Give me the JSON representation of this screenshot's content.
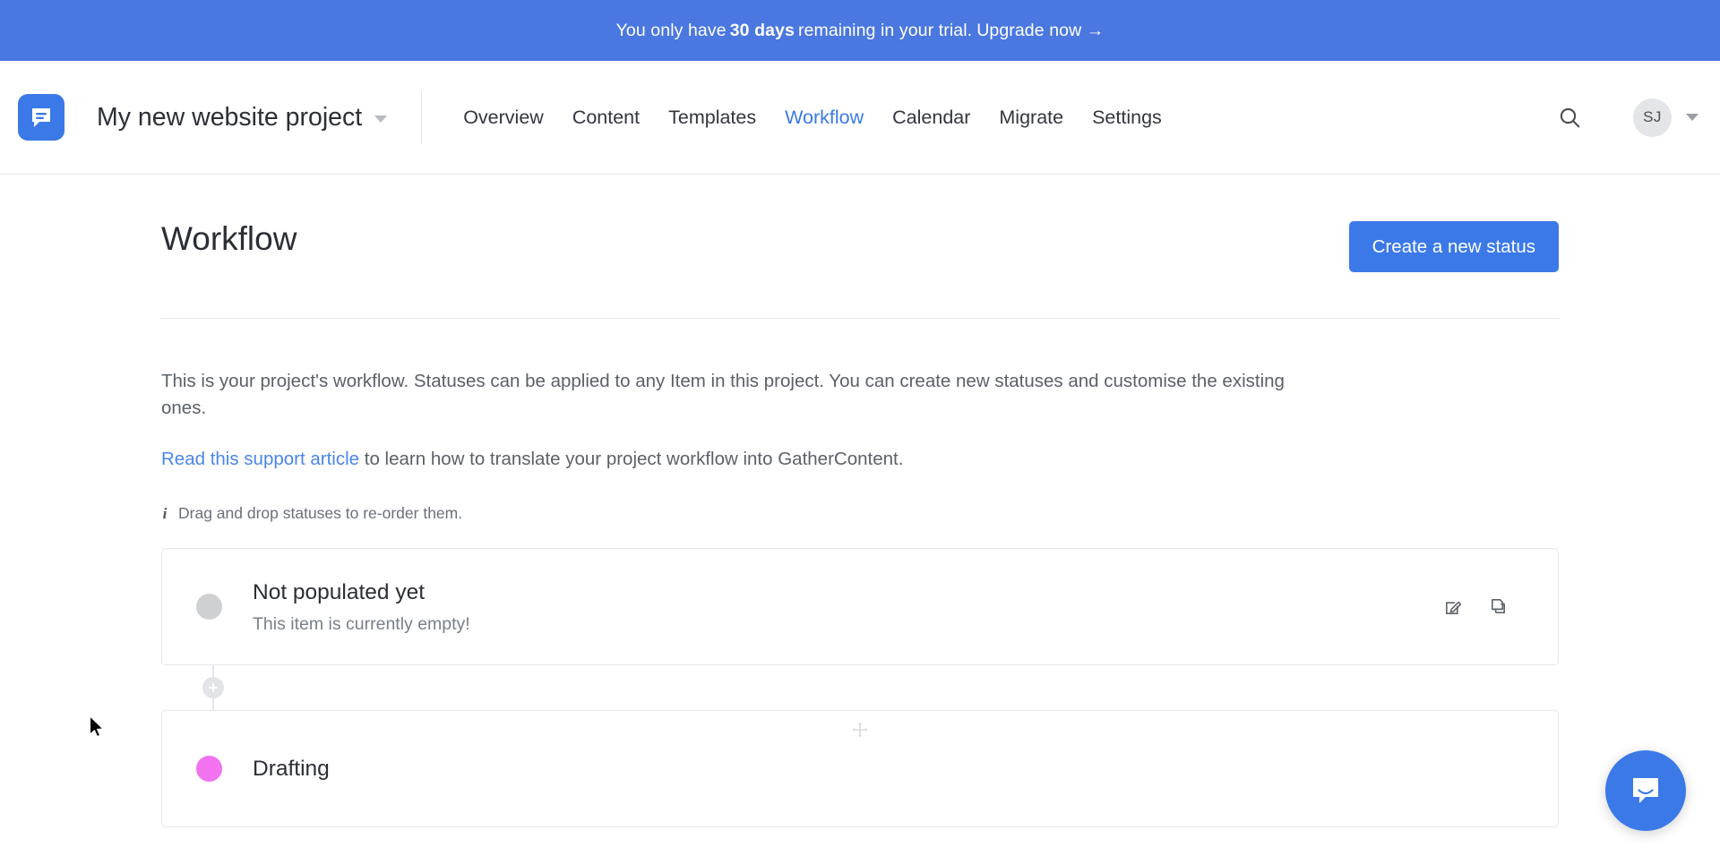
{
  "banner": {
    "text_before": "You only have",
    "highlight": "30 days",
    "text_after": "remaining in your trial.",
    "upgrade_label": "Upgrade now →",
    "background_color": "#4a77e0"
  },
  "header": {
    "logo_icon": "gathercontent-logo-icon",
    "project_name": "My new website project",
    "project_caret_icon": "chevron-down-icon",
    "nav_items": [
      {
        "label": "Overview",
        "active": false
      },
      {
        "label": "Content",
        "active": false
      },
      {
        "label": "Templates",
        "active": false
      },
      {
        "label": "Workflow",
        "active": true
      },
      {
        "label": "Calendar",
        "active": false
      },
      {
        "label": "Migrate",
        "active": false
      },
      {
        "label": "Settings",
        "active": false
      }
    ],
    "search_icon": "search-icon",
    "avatar_initials": "SJ",
    "avatar_caret_icon": "chevron-down-icon",
    "active_color": "#3b79e8"
  },
  "main": {
    "page_title": "Workflow",
    "create_status_label": "Create a new status",
    "intro_paragraph": "This is your project's workflow. Statuses can be applied to any Item in this project. You can create new statuses and customise the existing ones.",
    "support_link_label": "Read this support article",
    "support_link_suffix": " to learn how to translate your project workflow into GatherContent.",
    "hint_icon": "info-icon",
    "hint_text": "Drag and drop statuses to re-order them.",
    "statuses": [
      {
        "name": "Not populated yet",
        "description": "This item is currently empty!",
        "color": "#cfd0d2",
        "edit_icon": "edit-pencil-icon",
        "duplicate_icon": "duplicate-copy-icon"
      },
      {
        "name": "Drafting",
        "description": "",
        "color": "#f272ef",
        "edit_icon": "edit-pencil-icon",
        "duplicate_icon": "duplicate-copy-icon"
      }
    ],
    "add_status_icon": "plus-circle-icon",
    "drag_handle_icon": "move-arrows-icon"
  },
  "widgets": {
    "intercom_icon": "chat-bubble-icon",
    "intercom_color": "#3b79e8"
  },
  "cursor": {
    "icon": "mouse-pointer-icon"
  }
}
